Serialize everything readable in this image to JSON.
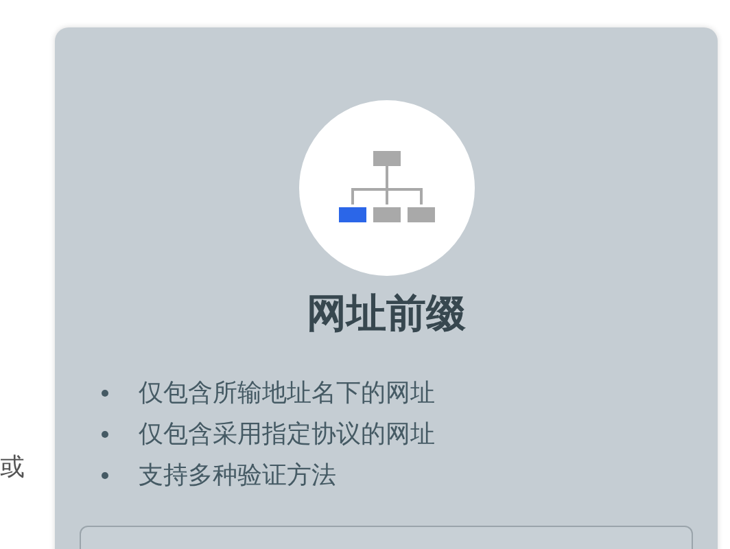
{
  "side_text": "或",
  "card": {
    "title": "网址前缀",
    "features": [
      "仅包含所输地址名下的网址",
      "仅包含采用指定协议的网址",
      "支持多种验证方法"
    ]
  }
}
